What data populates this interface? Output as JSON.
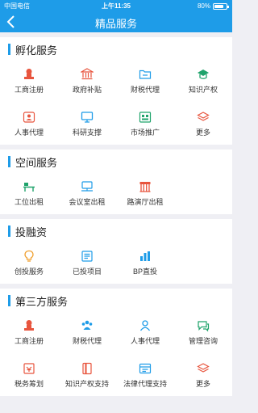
{
  "status_bar": {
    "carrier": "中国电信",
    "time": "上午11:35",
    "battery": "80%",
    "battery_level": 0.8
  },
  "nav": {
    "title": "精品服务"
  },
  "sections": [
    {
      "title": "孵化服务",
      "items": [
        {
          "label": "工商注册",
          "icon": "stamp-icon"
        },
        {
          "label": "政府补贴",
          "icon": "government-icon"
        },
        {
          "label": "财税代理",
          "icon": "folder-icon"
        },
        {
          "label": "知识产权",
          "icon": "graduation-cap-icon"
        },
        {
          "label": "人事代理",
          "icon": "hr-icon"
        },
        {
          "label": "科研支撑",
          "icon": "monitor-icon"
        },
        {
          "label": "市场推广",
          "icon": "market-icon"
        },
        {
          "label": "更多",
          "icon": "layers-icon"
        }
      ]
    },
    {
      "title": "空间服务",
      "items": [
        {
          "label": "工位出租",
          "icon": "desk-icon"
        },
        {
          "label": "会议室出租",
          "icon": "meeting-icon"
        },
        {
          "label": "路演厅出租",
          "icon": "hall-icon"
        }
      ]
    },
    {
      "title": "投融资",
      "items": [
        {
          "label": "创投服务",
          "icon": "lightbulb-icon"
        },
        {
          "label": "已投项目",
          "icon": "document-icon"
        },
        {
          "label": "BP直投",
          "icon": "chart-icon"
        }
      ]
    },
    {
      "title": "第三方服务",
      "items": [
        {
          "label": "工商注册",
          "icon": "stamp-icon"
        },
        {
          "label": "财税代理",
          "icon": "group-icon"
        },
        {
          "label": "人事代理",
          "icon": "user-icon"
        },
        {
          "label": "管理咨询",
          "icon": "chat-icon"
        },
        {
          "label": "税务筹划",
          "icon": "tax-icon"
        },
        {
          "label": "知识产权支持",
          "icon": "book-icon"
        },
        {
          "label": "法律代理支持",
          "icon": "law-icon"
        },
        {
          "label": "更多",
          "icon": "layers-icon"
        }
      ]
    }
  ],
  "colors": {
    "accent": "#1e9ce8",
    "icon_red": "#e8553e",
    "icon_blue": "#1e9ce8",
    "icon_orange": "#f0a030",
    "icon_green": "#1fa36b"
  }
}
